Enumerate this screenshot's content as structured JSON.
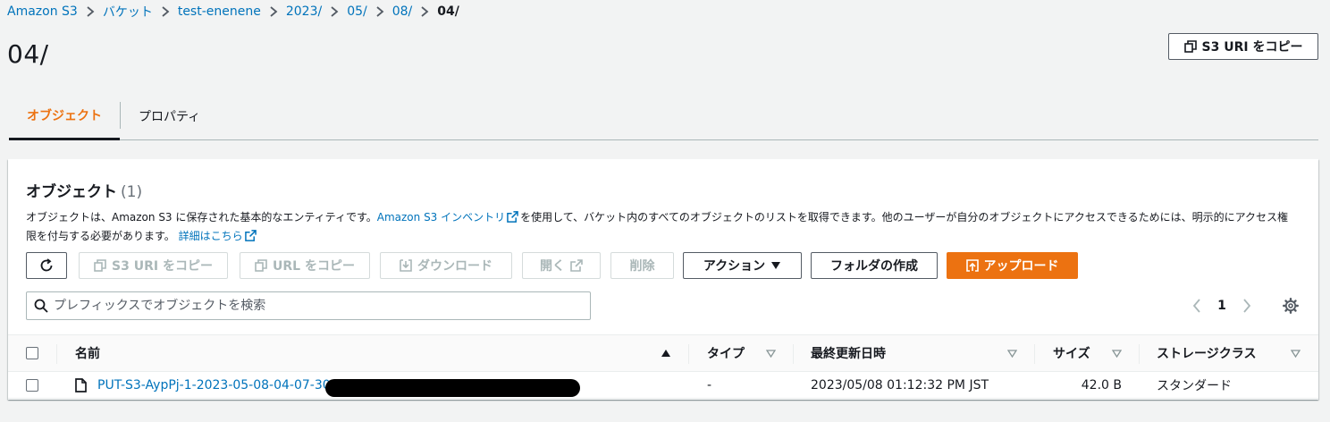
{
  "breadcrumb": [
    "Amazon S3",
    "バケット",
    "test-enenene",
    "2023/",
    "05/",
    "08/",
    "04/"
  ],
  "page": {
    "title": "04/",
    "copy_s3_uri_label": "S3 URI をコピー"
  },
  "tabs": [
    {
      "label": "オブジェクト",
      "active": true
    },
    {
      "label": "プロパティ",
      "active": false
    }
  ],
  "panel": {
    "heading": "オブジェクト",
    "count": "(1)",
    "desc_part1": "オブジェクトは、Amazon S3 に保存された基本的なエンティティです。",
    "desc_link1": "Amazon S3 インベントリ",
    "desc_part2": "を使用して、バケット内のすべてのオブジェクトのリストを取得できます。他のユーザーが自分のオブジェクトにアクセスできるためには、明示的にアクセス権限を付与する必要があります。",
    "desc_link2": "詳細はこちら"
  },
  "toolbar": {
    "copy_s3_uri": "S3 URI をコピー",
    "copy_url": "URL をコピー",
    "download": "ダウンロード",
    "open": "開く",
    "delete": "削除",
    "actions": "アクション",
    "create_folder": "フォルダの作成",
    "upload": "アップロード"
  },
  "search": {
    "placeholder": "プレフィックスでオブジェクトを検索"
  },
  "pagination": {
    "current_page": "1"
  },
  "table": {
    "columns": {
      "name": "名前",
      "type": "タイプ",
      "last_modified": "最終更新日時",
      "size": "サイズ",
      "storage_class": "ストレージクラス"
    },
    "rows": [
      {
        "name": "PUT-S3-AypPj-1-2023-05-08-04-07-30-",
        "type": "-",
        "last_modified": "2023/05/08 01:12:32 PM JST",
        "size": "42.0 B",
        "storage_class": "スタンダード"
      }
    ]
  },
  "colors": {
    "link": "#0073bb",
    "accent": "#ec7211",
    "text": "#16191f",
    "background": "#f2f3f3"
  }
}
